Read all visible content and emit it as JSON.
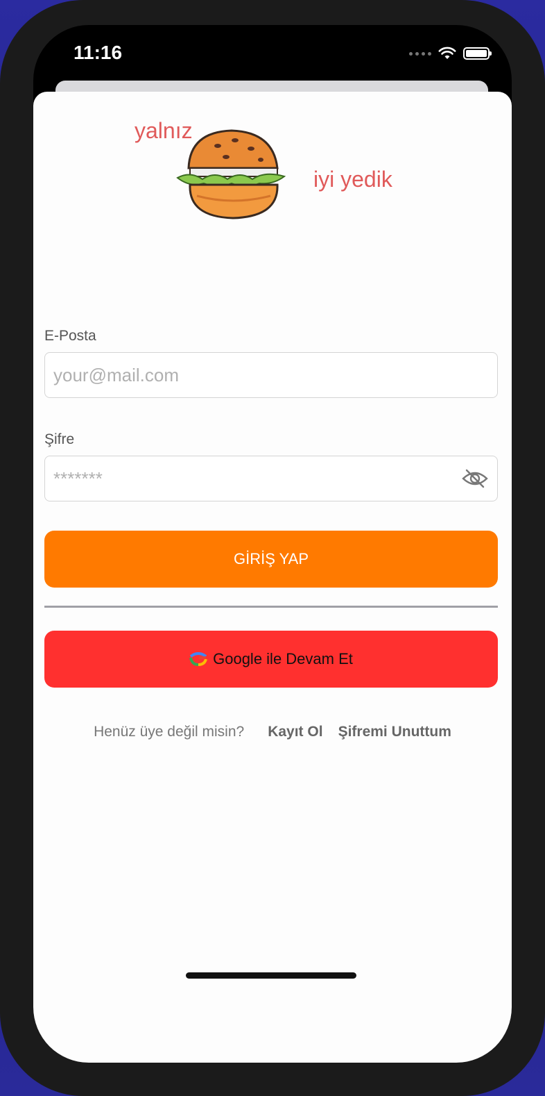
{
  "status_bar": {
    "time": "11:16"
  },
  "logo": {
    "text_top": "yalnız",
    "text_bottom": "iyi yedik",
    "icon": "burger-icon"
  },
  "form": {
    "email": {
      "label": "E-Posta",
      "placeholder": "your@mail.com",
      "value": ""
    },
    "password": {
      "label": "Şifre",
      "placeholder": "*******",
      "value": "",
      "toggle_icon": "eye-off-icon"
    },
    "login_button": "GİRİŞ YAP",
    "google_button": "Google ile Devam Et",
    "google_icon": "google-icon"
  },
  "links": {
    "question": "Henüz üye değil misin?",
    "register": "Kayıt Ol",
    "forgot": "Şifremi Unuttum"
  },
  "colors": {
    "primary": "#ff7a00",
    "google": "#ff302f",
    "logo_text": "#e05a5a"
  }
}
